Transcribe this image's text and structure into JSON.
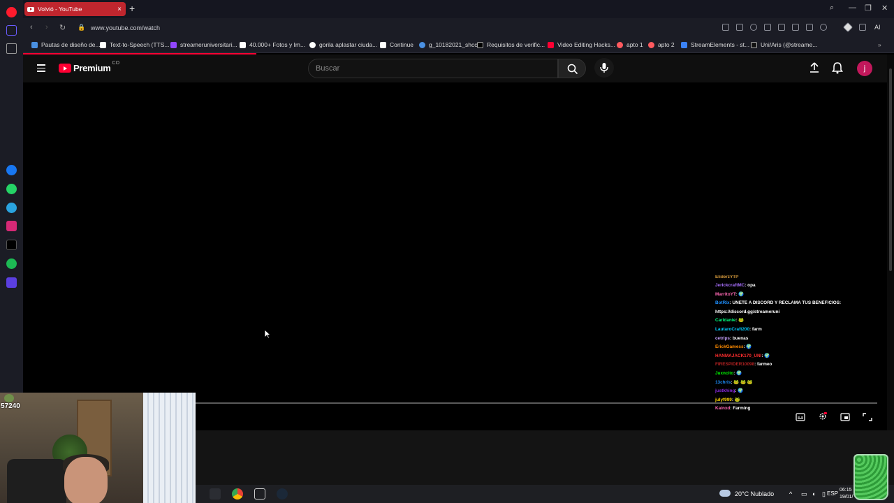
{
  "browser": {
    "tab_title": "Volvió - YouTube",
    "address": "www.youtube.com/watch",
    "bookmarks": [
      {
        "label": "Pautas de diseño de...",
        "color": "#4a90e2"
      },
      {
        "label": "Text-to-Speech (TTS...",
        "color": "#ffffff"
      },
      {
        "label": "streameruniversitari...",
        "color": "#9146ff"
      },
      {
        "label": "40.000+ Fotos y Im...",
        "color": "#ffffff"
      },
      {
        "label": "gorila aplastar ciuda...",
        "color": "#ffffff"
      },
      {
        "label": "Continue",
        "color": "#ffffff"
      },
      {
        "label": "g_10182021_shcc",
        "color": "#4a90e2"
      },
      {
        "label": "Requisitos de verific...",
        "color": "#ffffff"
      },
      {
        "label": "Video Editing Hacks...",
        "color": "#ff0033"
      },
      {
        "label": "apto 1",
        "color": "#ff5a5f"
      },
      {
        "label": "apto 2",
        "color": "#ff5a5f"
      },
      {
        "label": "StreamElements - st...",
        "color": "#3b82f6"
      },
      {
        "label": "Uni/Aris (@streame...",
        "color": "#ffffff"
      }
    ],
    "ai_label": "AI"
  },
  "youtube": {
    "logo_text": "Premium",
    "country": "CO",
    "search_placeholder": "Buscar",
    "avatar_letter": "j"
  },
  "chat": [
    {
      "user": "EliderzYTP",
      "msg": "",
      "color": "#d79b3c"
    },
    {
      "user": "JerickcraftMC",
      "msg": ": opa",
      "color": "#a970ff"
    },
    {
      "user": "MarritoYT",
      "msg": ": 🌍",
      "color": "#ff69b4"
    },
    {
      "user": "BotRix",
      "msg": ": UNETE A DISCORD Y RECLAMA TUS BENEFICIOS:",
      "color": "#1e90ff"
    },
    {
      "user": "",
      "msg": "https://discord.gg/streameruni",
      "color": "#ffffff"
    },
    {
      "user": "Carldanie",
      "msg": ": 🐸",
      "color": "#00ff7f"
    },
    {
      "user": "LautaroCraft200",
      "msg": ": farm",
      "color": "#00ccff"
    },
    {
      "user": "cetrips",
      "msg": ": buenas",
      "color": "#c8a2ff"
    },
    {
      "user": "ErickGamess",
      "msg": ": 🌍",
      "color": "#ff8c00"
    },
    {
      "user": "HANMAJACK170_UNI",
      "msg": ": 🌍",
      "color": "#ff2e2e"
    },
    {
      "user": "FIRESPIDER10098",
      "msg": ": farmeo",
      "color": "#b22222"
    },
    {
      "user": "Juxncito",
      "msg": ": 🌍",
      "color": "#00ff00"
    },
    {
      "user": "13chris",
      "msg": ": 🐸 🐸 🐸",
      "color": "#1e90ff"
    },
    {
      "user": "justkhing",
      "msg": ": 🌍",
      "color": "#8a2be2"
    },
    {
      "user": "julyf999",
      "msg": ": 🐸",
      "color": "#ffd700"
    },
    {
      "user": "Kainxd",
      "msg": ": Farming",
      "color": "#ff69b4"
    }
  ],
  "webcam": {
    "counter": "57240"
  },
  "taskbar": {
    "weather": "20°C  Nublado",
    "lang": "ESP",
    "time": "06:15",
    "date": "19/01/"
  }
}
